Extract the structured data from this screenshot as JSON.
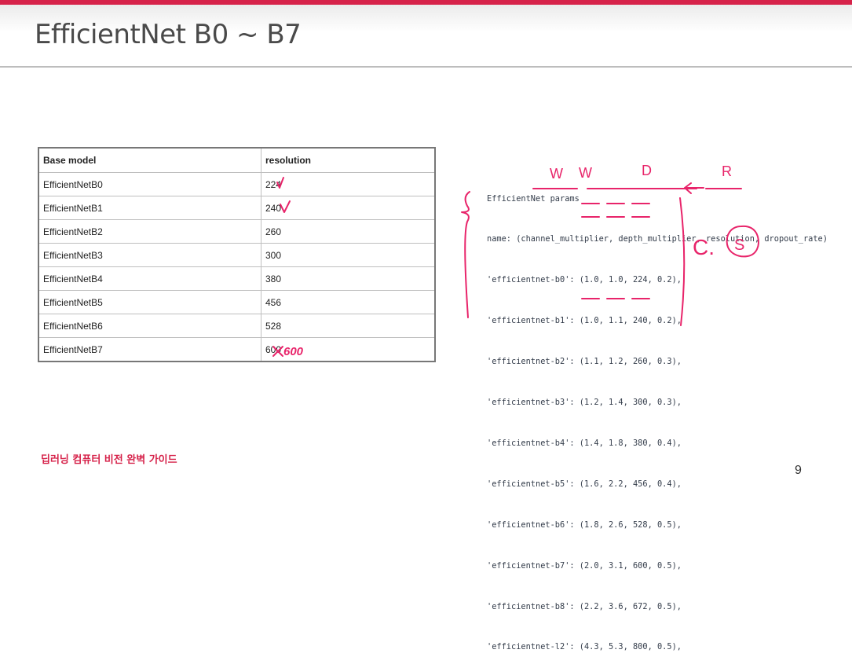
{
  "slide": {
    "title": "EfficientNet B0 ~ B7",
    "footer": "딥러닝 컴퓨터 비전 완벽 가이드",
    "page_number": "9"
  },
  "table": {
    "headers": [
      "Base model",
      "resolution"
    ],
    "rows": [
      {
        "model": "EfficientNetB0",
        "resolution": "224"
      },
      {
        "model": "EfficientNetB1",
        "resolution": "240"
      },
      {
        "model": "EfficientNetB2",
        "resolution": "260"
      },
      {
        "model": "EfficientNetB3",
        "resolution": "300"
      },
      {
        "model": "EfficientNetB4",
        "resolution": "380"
      },
      {
        "model": "EfficientNetB5",
        "resolution": "456"
      },
      {
        "model": "EfficientNetB6",
        "resolution": "528"
      },
      {
        "model": "EfficientNetB7",
        "resolution": "600"
      }
    ]
  },
  "code": {
    "lines": [
      "EfficientNet params",
      "name: (channel_multiplier, depth_multiplier, resolution, dropout_rate)",
      "'efficientnet-b0': (1.0, 1.0, 224, 0.2),",
      "'efficientnet-b1': (1.0, 1.1, 240, 0.2),",
      "'efficientnet-b2': (1.1, 1.2, 260, 0.3),",
      "'efficientnet-b3': (1.2, 1.4, 300, 0.3),",
      "'efficientnet-b4': (1.4, 1.8, 380, 0.4),",
      "'efficientnet-b5': (1.6, 2.2, 456, 0.4),",
      "'efficientnet-b6': (1.8, 2.6, 528, 0.5),",
      "'efficientnet-b7': (2.0, 3.1, 600, 0.5),",
      "'efficientnet-b8': (2.2, 3.6, 672, 0.5),",
      "'efficientnet-l2': (4.3, 5.3, 800, 0.5),"
    ]
  },
  "annotations": {
    "width_label": "W",
    "depth_label": "D",
    "resolution_label": "R",
    "compound_c": "C.",
    "compound_s": "S",
    "b7_correction": "600"
  },
  "colors": {
    "accent": "#d6224a",
    "ink": "#e8246a"
  }
}
